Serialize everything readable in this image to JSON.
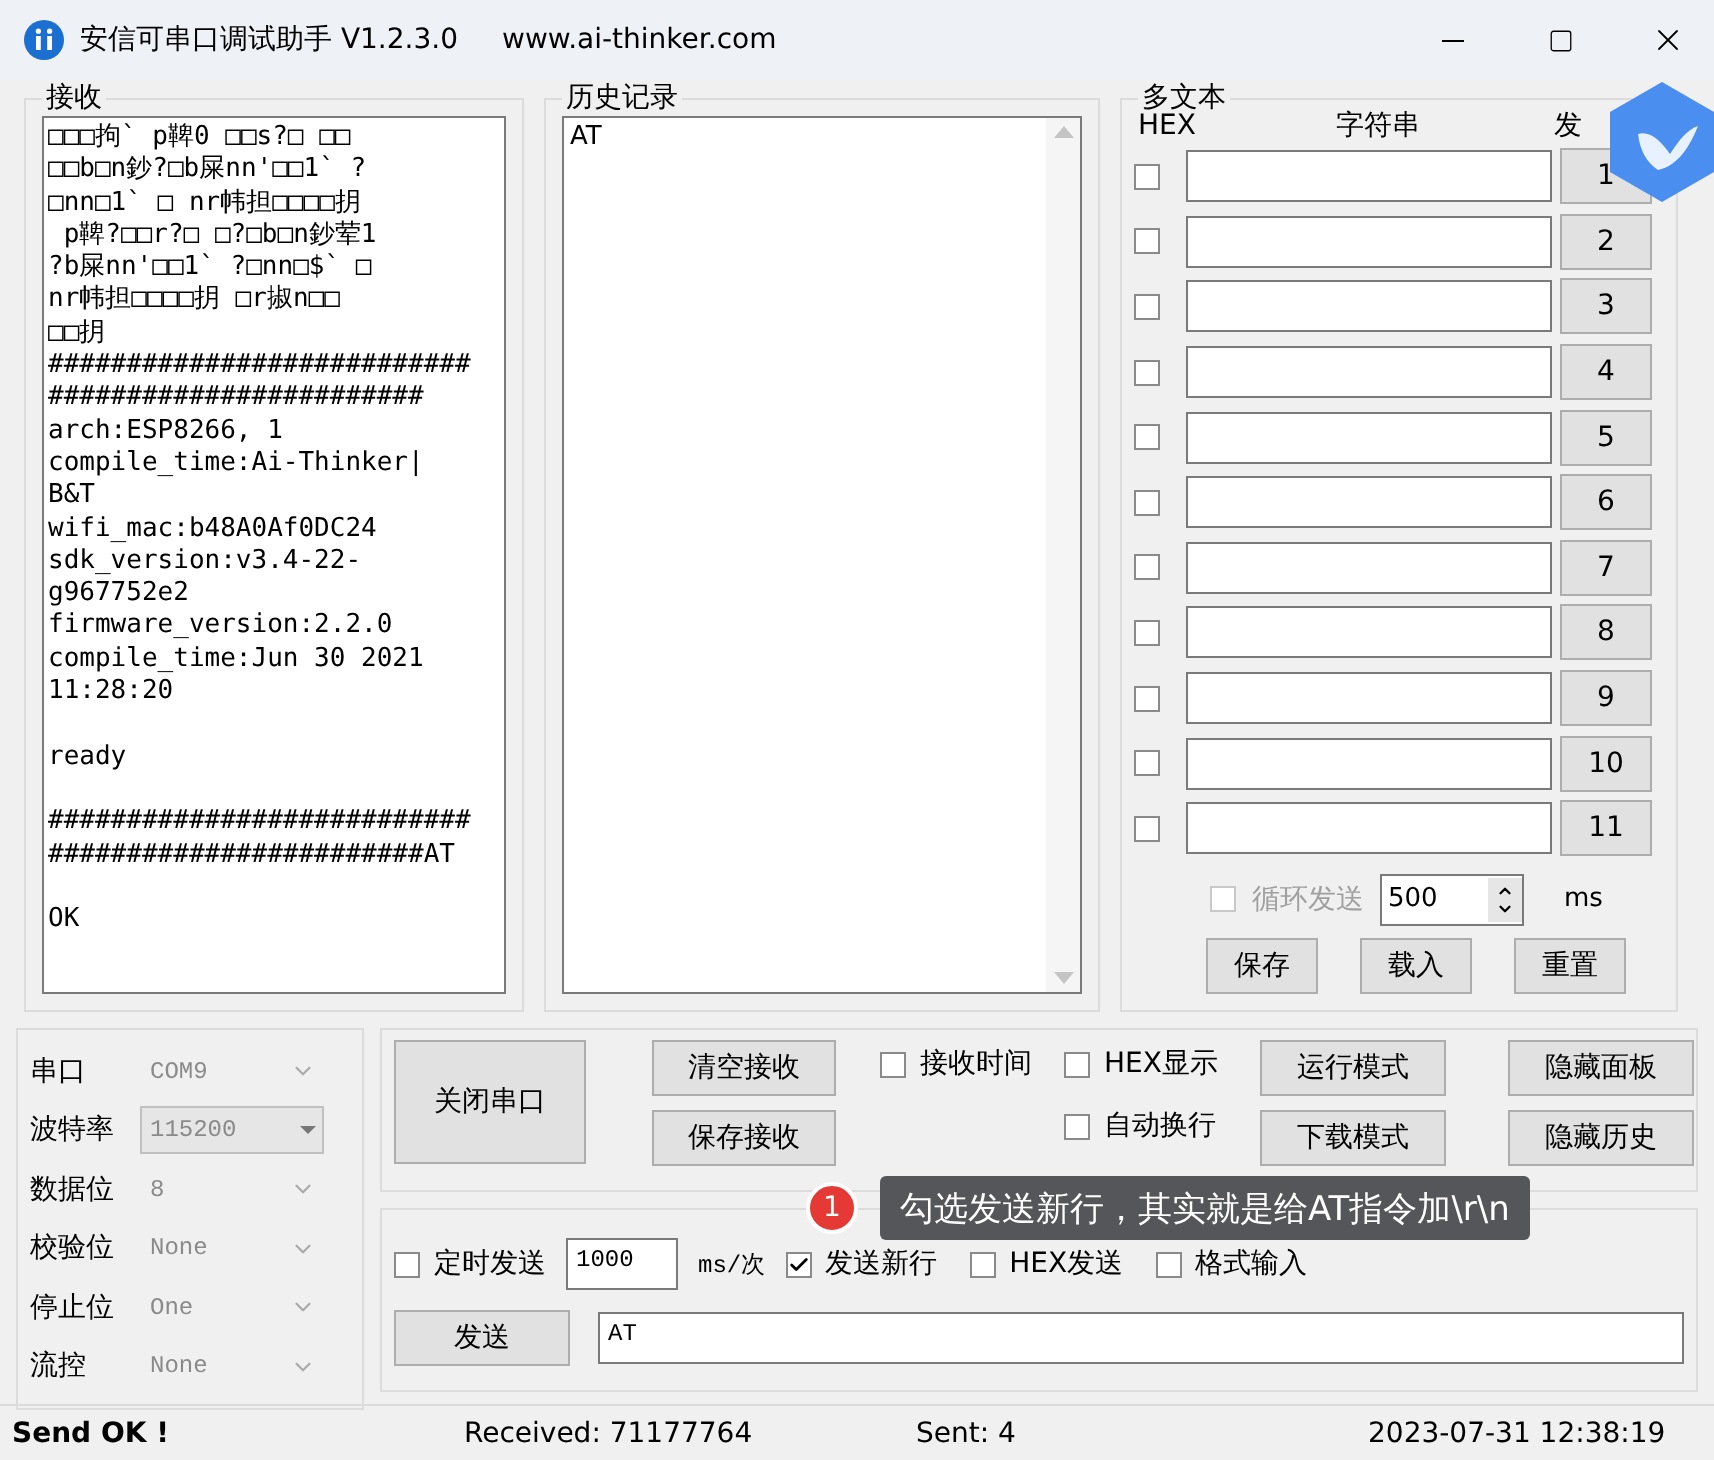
{
  "window": {
    "title": "安信可串口调试助手 V1.2.3.0",
    "url": "www.ai-thinker.com"
  },
  "receive": {
    "title": "接收",
    "blocks": [
      [
        "□□□拘` p鞞0 □□s?□ □□",
        "□□b□n鈔?□b屎nn'□□1` ?",
        "□nn□1` □ nr帏担□□□□抈",
        " p鞞?□□r?□ □?□b□n鈔荤1",
        "?b屎nn'□□1` ?□nn□$` □",
        "nr帏担□□□□抈 □r掓n□□",
        "□□抈",
        "###########################",
        "########################",
        "arch:ESP8266, 1",
        "compile_time:Ai-Thinker|",
        "B&T",
        "wifi_mac:b48A0Af0DC24",
        "sdk_version:v3.4-22-",
        "g967752e2",
        "firmware_version:2.2.0",
        "compile_time:Jun 30 2021",
        "11:28:20"
      ],
      [
        "ready"
      ],
      [
        "###########################",
        "########################AT"
      ],
      [
        "OK"
      ]
    ]
  },
  "history": {
    "title": "历史记录",
    "items": [
      "AT"
    ]
  },
  "multi_text": {
    "title": "多文本",
    "headers": [
      "HEX",
      "字符串",
      "发"
    ],
    "rows": [
      {
        "checked": false,
        "button": "1"
      },
      {
        "checked": false,
        "button": "2"
      },
      {
        "checked": false,
        "button": "3"
      },
      {
        "checked": false,
        "button": "4"
      },
      {
        "checked": false,
        "button": "5"
      },
      {
        "checked": false,
        "button": "6"
      },
      {
        "checked": false,
        "button": "7"
      },
      {
        "checked": false,
        "button": "8"
      },
      {
        "checked": false,
        "button": "9"
      },
      {
        "checked": false,
        "button": "10"
      },
      {
        "checked": false,
        "button": "11"
      }
    ],
    "loop": {
      "label": "循环发送",
      "checked": false,
      "disabled": true,
      "interval": "500",
      "unit": "ms"
    },
    "buttons": [
      "保存",
      "载入",
      "重置"
    ]
  },
  "port_settings": [
    {
      "label": "串口",
      "value": "COM9",
      "kind": "select"
    },
    {
      "label": "波特率",
      "value": "115200",
      "kind": "combo"
    },
    {
      "label": "数据位",
      "value": "8",
      "kind": "select"
    },
    {
      "label": "校验位",
      "value": "None",
      "kind": "select"
    },
    {
      "label": "停止位",
      "value": "One",
      "kind": "select"
    },
    {
      "label": "流控",
      "value": "None",
      "kind": "select"
    }
  ],
  "controls": {
    "open_button": "关闭串口",
    "receive_buttons": [
      "清空接收",
      "保存接收"
    ],
    "options": [
      {
        "label": "接收时间",
        "checked": false
      },
      {
        "label": "HEX显示",
        "checked": false
      },
      {
        "label": "自动换行",
        "checked": false
      }
    ],
    "mode_buttons": [
      "运行模式",
      "下载模式"
    ],
    "panel_buttons": [
      "隐藏面板",
      "隐藏历史"
    ]
  },
  "send": {
    "timed": {
      "label": "定时发送",
      "checked": false,
      "interval": "1000",
      "unit": "ms/次"
    },
    "options": [
      {
        "label": "发送新行",
        "checked": true
      },
      {
        "label": "HEX发送",
        "checked": false
      },
      {
        "label": "格式输入",
        "checked": false
      }
    ],
    "button": "发送",
    "value": "AT"
  },
  "tooltip": {
    "badge": "1",
    "text": "勾选发送新行，其实就是给AT指令加\\r\\n"
  },
  "status_bar": {
    "message": "Send OK !",
    "received": "Received: 71177764",
    "sent": "Sent: 4",
    "time": "2023-07-31 12:38:19"
  }
}
